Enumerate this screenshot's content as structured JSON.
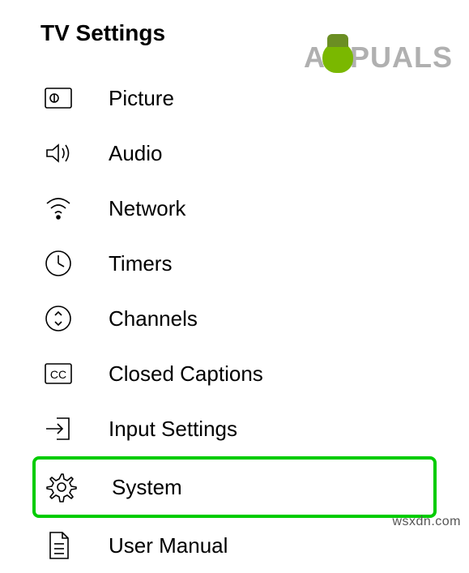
{
  "title": "TV Settings",
  "menu": [
    {
      "key": "picture",
      "label": "Picture",
      "icon": "picture-icon",
      "highlighted": false
    },
    {
      "key": "audio",
      "label": "Audio",
      "icon": "audio-icon",
      "highlighted": false
    },
    {
      "key": "network",
      "label": "Network",
      "icon": "network-icon",
      "highlighted": false
    },
    {
      "key": "timers",
      "label": "Timers",
      "icon": "timers-icon",
      "highlighted": false
    },
    {
      "key": "channels",
      "label": "Channels",
      "icon": "channels-icon",
      "highlighted": false
    },
    {
      "key": "closed-captions",
      "label": "Closed Captions",
      "icon": "cc-icon",
      "highlighted": false
    },
    {
      "key": "input-settings",
      "label": "Input Settings",
      "icon": "input-icon",
      "highlighted": false
    },
    {
      "key": "system",
      "label": "System",
      "icon": "gear-icon",
      "highlighted": true
    },
    {
      "key": "user-manual",
      "label": "User Manual",
      "icon": "manual-icon",
      "highlighted": false
    }
  ],
  "watermark": {
    "prefix": "A",
    "suffix": "PUALS"
  },
  "source": "wsxdn.com",
  "colors": {
    "highlight": "#00cc00"
  }
}
